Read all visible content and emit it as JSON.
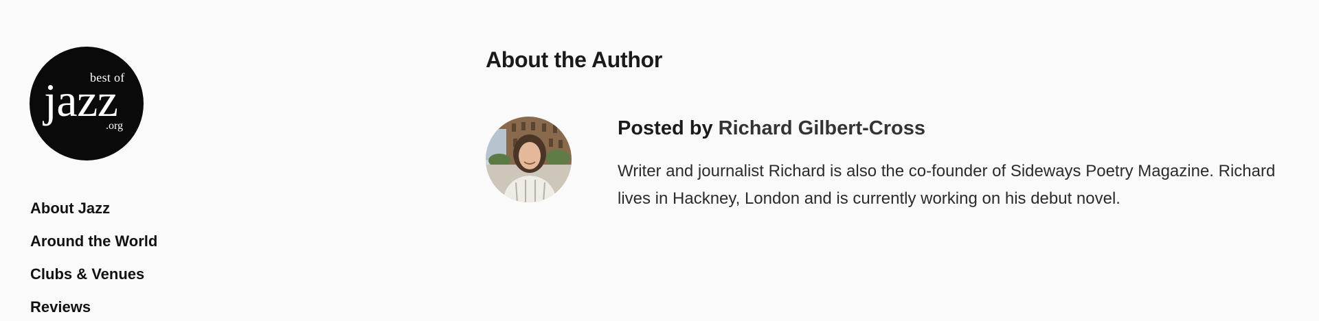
{
  "logo": {
    "top_text": "best of",
    "word": "jazz",
    "tld": ".org"
  },
  "nav": {
    "items": [
      {
        "label": "About Jazz"
      },
      {
        "label": "Around the World"
      },
      {
        "label": "Clubs & Venues"
      },
      {
        "label": "Reviews"
      }
    ]
  },
  "author_box": {
    "heading": "About the Author",
    "posted_prefix": "Posted by",
    "author_name": "Richard Gilbert-Cross",
    "bio": "Writer and journalist Richard is also the co-founder of Sideways Poetry Magazine. Richard lives in Hackney, London and is currently working on his debut novel."
  },
  "colors": {
    "background": "#fafafa",
    "logo_bg": "#0a0a0a",
    "text": "#1a1a1a",
    "author_link": "#333333"
  }
}
